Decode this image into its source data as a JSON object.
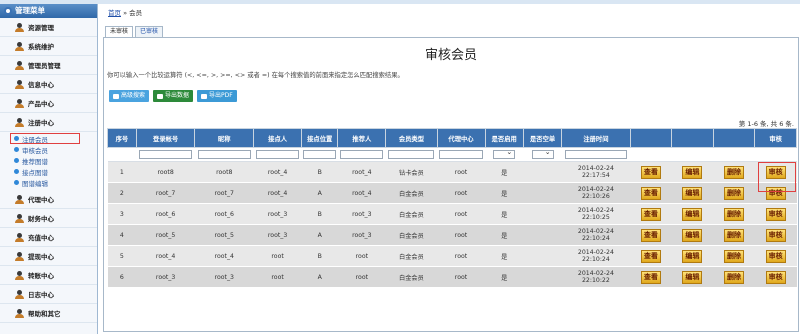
{
  "sidebar": {
    "header": "管理菜单",
    "items_top": [
      {
        "label": "资源管理"
      },
      {
        "label": "系统维护"
      },
      {
        "label": "管理员管理"
      },
      {
        "label": "信息中心"
      },
      {
        "label": "产品中心"
      },
      {
        "label": "注册中心"
      }
    ],
    "sub_items": [
      {
        "label": "注册会员"
      },
      {
        "label": "审核会员"
      },
      {
        "label": "推荐图谱"
      },
      {
        "label": "接点图谱"
      },
      {
        "label": "图谱编辑"
      }
    ],
    "items_bottom": [
      {
        "label": "代理中心"
      },
      {
        "label": "财务中心"
      },
      {
        "label": "充值中心"
      },
      {
        "label": "提现中心"
      },
      {
        "label": "转账中心"
      },
      {
        "label": "日志中心"
      },
      {
        "label": "帮助和其它"
      }
    ]
  },
  "breadcrumb": {
    "home": "首页",
    "sep": "»",
    "current": "会员"
  },
  "tabs": [
    "未审核",
    "已审核"
  ],
  "page_title": "审核会员",
  "hint": "你可以输入一个比较运算符 (<, <=, >, >=, <> 或者 =) 在每个搜索值的前面来指定怎么匹配搜索结果。",
  "toolbar": {
    "search": "高级搜索",
    "export_data": "导出数据",
    "export_pdf": "导出PDF"
  },
  "pager": "第 1-6 条, 共 6 条.",
  "table": {
    "columns": [
      "序号",
      "登录帐号",
      "昵称",
      "接点人",
      "接点位置",
      "推荐人",
      "会员类型",
      "代理中心",
      "是否启用",
      "是否空单",
      "注册时间",
      "",
      "",
      "",
      "审核"
    ],
    "actions": {
      "view": "查看",
      "edit": "编辑",
      "delete": "删除",
      "audit": "审核"
    },
    "rows": [
      {
        "no": "1",
        "account": "root8",
        "nick": "root8",
        "contact": "root_4",
        "pos": "B",
        "referrer": "root_4",
        "type": "钻卡会员",
        "agent": "root",
        "enabled": "是",
        "date": "2014-02-24",
        "time": "22:17:54"
      },
      {
        "no": "2",
        "account": "root_7",
        "nick": "root_7",
        "contact": "root_4",
        "pos": "A",
        "referrer": "root_4",
        "type": "白金会员",
        "agent": "root",
        "enabled": "是",
        "date": "2014-02-24",
        "time": "22:10:26"
      },
      {
        "no": "3",
        "account": "root_6",
        "nick": "root_6",
        "contact": "root_3",
        "pos": "B",
        "referrer": "root_3",
        "type": "白金会员",
        "agent": "root",
        "enabled": "是",
        "date": "2014-02-24",
        "time": "22:10:25"
      },
      {
        "no": "4",
        "account": "root_5",
        "nick": "root_5",
        "contact": "root_3",
        "pos": "A",
        "referrer": "root_3",
        "type": "白金会员",
        "agent": "root",
        "enabled": "是",
        "date": "2014-02-24",
        "time": "22:10:24"
      },
      {
        "no": "5",
        "account": "root_4",
        "nick": "root_4",
        "contact": "root",
        "pos": "B",
        "referrer": "root",
        "type": "白金会员",
        "agent": "root",
        "enabled": "是",
        "date": "2014-02-24",
        "time": "22:10:24"
      },
      {
        "no": "6",
        "account": "root_3",
        "nick": "root_3",
        "contact": "root",
        "pos": "A",
        "referrer": "root",
        "type": "白金会员",
        "agent": "root",
        "enabled": "是",
        "date": "2014-02-24",
        "time": "22:10:22"
      }
    ]
  }
}
